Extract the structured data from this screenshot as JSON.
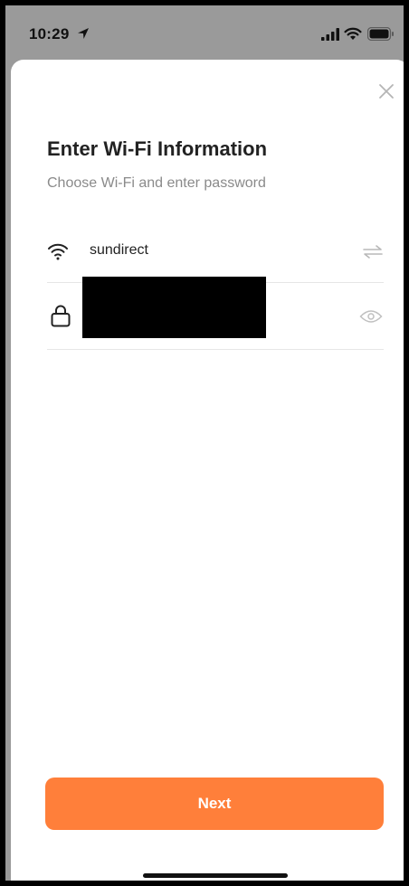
{
  "status_bar": {
    "time": "10:29",
    "icons": [
      "location-arrow-icon",
      "cellular-signal-icon",
      "wifi-icon",
      "battery-icon"
    ]
  },
  "dialog": {
    "close_icon": "close-icon",
    "title": "Enter Wi-Fi Information",
    "subtitle": "Choose Wi-Fi and enter password",
    "network": {
      "icon": "wifi-icon",
      "ssid": "sundirect",
      "switch_icon": "switch-network-icon"
    },
    "password": {
      "icon": "lock-icon",
      "value": "",
      "visibility_icon": "eye-icon"
    },
    "next_label": "Next"
  },
  "colors": {
    "accent": "#ff7f3a",
    "title_text": "#222222",
    "subtitle_text": "#8a8a8a",
    "divider": "#e6e6e6",
    "backdrop": "#9a9a9a"
  }
}
